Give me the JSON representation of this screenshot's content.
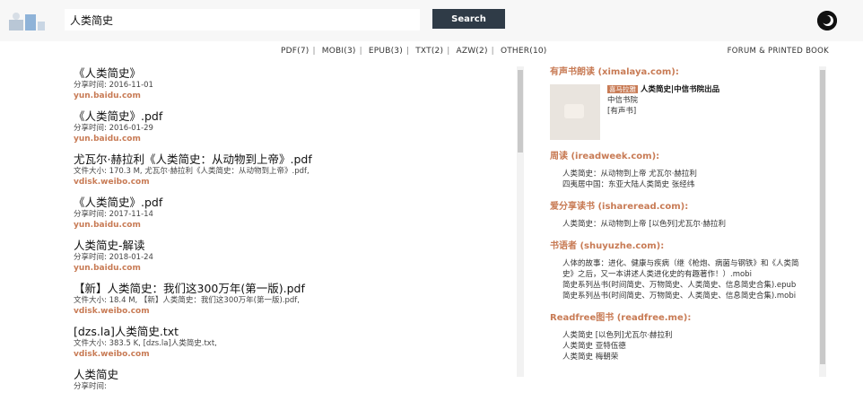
{
  "search": {
    "value": "人类简史",
    "button_label": "Search"
  },
  "format_bar": [
    {
      "label": "PDF(7)"
    },
    {
      "label": "MOBI(3)"
    },
    {
      "label": "EPUB(3)"
    },
    {
      "label": "TXT(2)"
    },
    {
      "label": "AZW(2)"
    },
    {
      "label": "OTHER(10)"
    }
  ],
  "forum_link": "FORUM & PRINTED BOOK",
  "results": [
    {
      "title": "《人类简史》",
      "meta": "分享时间: 2016-11-01",
      "source": "yun.baidu.com"
    },
    {
      "title": "《人类简史》.pdf",
      "meta": "分享时间: 2016-01-29",
      "source": "yun.baidu.com"
    },
    {
      "title": "尤瓦尔·赫拉利《人类简史：从动物到上帝》.pdf",
      "meta": "文件大小: 170.3 M, 尤瓦尔·赫拉利《人类简史：从动物到上帝》.pdf,",
      "source": "vdisk.weibo.com"
    },
    {
      "title": "《人类简史》.pdf",
      "meta": "分享时间: 2017-11-14",
      "source": "yun.baidu.com"
    },
    {
      "title": "人类简史-解读",
      "meta": "分享时间: 2018-01-24",
      "source": "yun.baidu.com"
    },
    {
      "title": "【新】人类简史：我们这300万年(第一版).pdf",
      "meta": "文件大小: 18.4 M, 【新】人类简史：我们这300万年(第一版).pdf,",
      "source": "vdisk.weibo.com"
    },
    {
      "title": "[dzs.la]人类简史.txt",
      "meta": "文件大小: 383.5 K, [dzs.la]人类简史.txt,",
      "source": "vdisk.weibo.com"
    },
    {
      "title": "人类简史",
      "meta": "分享时间:",
      "source": ""
    }
  ],
  "sidebar": {
    "audio": {
      "title": "有声书朗读 (ximalaya.com):",
      "badge": "喜马拉雅",
      "book_title": "人类简史|中信书院出品",
      "publisher": "中信书院",
      "tag": "[有声书]"
    },
    "sections": [
      {
        "title": "周读 (ireadweek.com):",
        "items": [
          "人类简史：从动物到上帝 尤瓦尔·赫拉利",
          "四夷居中国：东亚大陆人类简史 张经纬"
        ]
      },
      {
        "title": "爱分享读书 (ishareread.com):",
        "items": [
          "人类简史：从动物到上帝 [以色列]尤瓦尔·赫拉利"
        ]
      },
      {
        "title": "书语者 (shuyuzhe.com):",
        "items": [
          "人体的故事：进化、健康与疾病（继《枪炮、病菌与钢铁》和《人类简",
          "史》之后，又一本讲述人类进化史的有趣著作！）.mobi",
          "简史系列丛书(时间简史、万物简史、人类简史、信息简史合集).epub",
          "简史系列丛书(时间简史、万物简史、人类简史、信息简史合集).mobi"
        ]
      },
      {
        "title": "Readfree图书 (readfree.me):",
        "items": [
          "人类简史 [以色列]尤瓦尔·赫拉利",
          "人类简史 亚特伍德",
          "人类简史 梅朝荣"
        ]
      }
    ]
  },
  "colors": {
    "accent": "#c87b55",
    "button": "#2f3b47"
  }
}
